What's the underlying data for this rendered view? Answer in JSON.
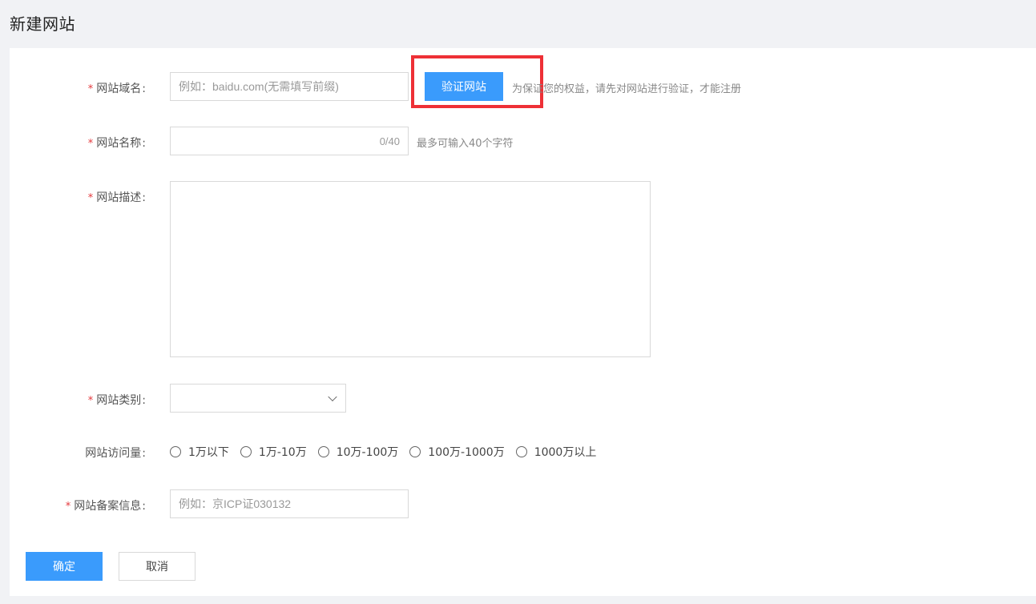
{
  "page": {
    "title": "新建网站"
  },
  "form": {
    "domain": {
      "label": "网站域名",
      "placeholder": "例如：baidu.com(无需填写前缀)",
      "verify_button": "验证网站",
      "hint": "为保证您的权益，请先对网站进行验证，才能注册"
    },
    "name": {
      "label": "网站名称",
      "counter": "0/40",
      "hint": "最多可输入40个字符"
    },
    "description": {
      "label": "网站描述"
    },
    "category": {
      "label": "网站类别",
      "selected": ""
    },
    "traffic": {
      "label": "网站访问量",
      "options": [
        "1万以下",
        "1万-10万",
        "10万-100万",
        "100万-1000万",
        "1000万以上"
      ]
    },
    "icp": {
      "label": "网站备案信息",
      "placeholder": "例如：京ICP证030132"
    },
    "required_mark": "*",
    "colon": ":"
  },
  "actions": {
    "confirm": "确定",
    "cancel": "取消"
  },
  "colors": {
    "primary": "#3a9bfc",
    "required": "#e4393c",
    "highlight": "#ee3036",
    "background": "#f1f2f5"
  }
}
